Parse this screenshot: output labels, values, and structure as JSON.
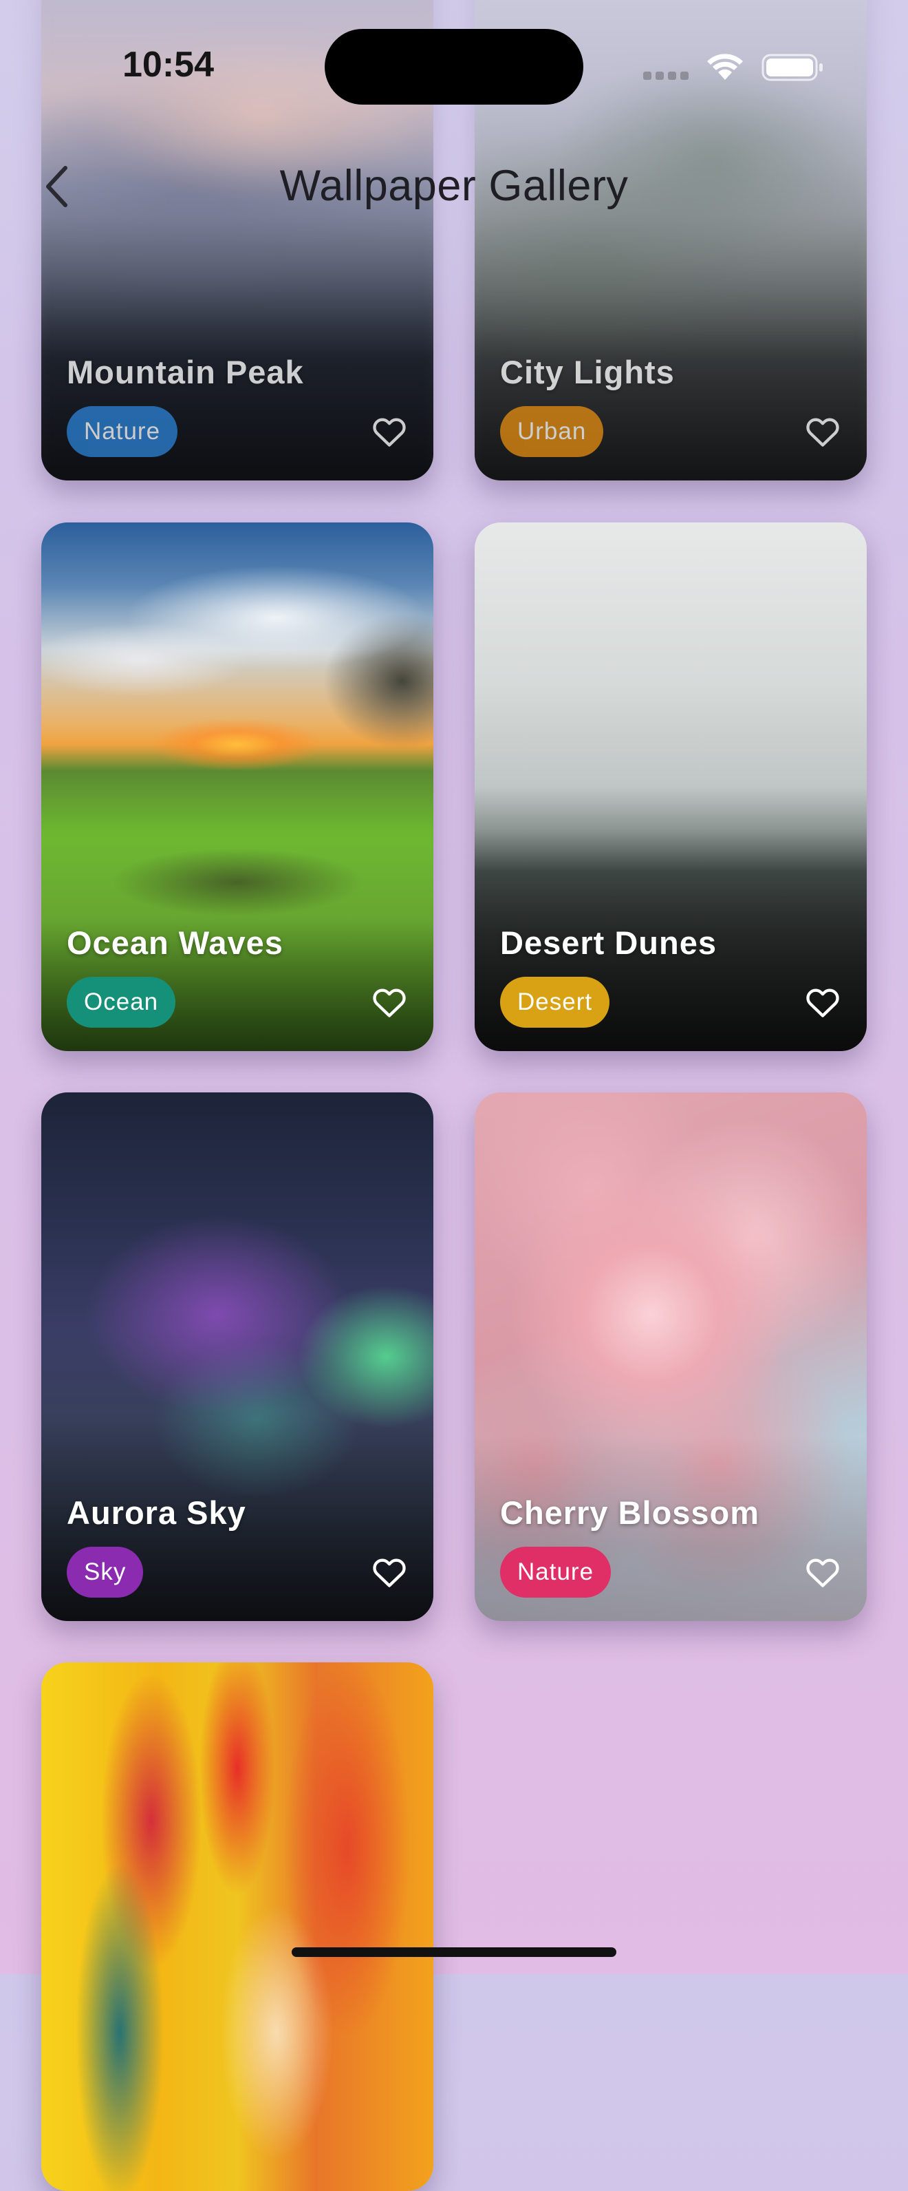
{
  "status_bar": {
    "time": "10:54"
  },
  "nav": {
    "title": "Wallpaper Gallery",
    "back_icon": "chevron-left-icon"
  },
  "cards": [
    {
      "title": "Mountain Peak",
      "tag": "Nature",
      "tag_color": "#2b7fd0",
      "favorite_icon": "heart-outline-icon"
    },
    {
      "title": "City Lights",
      "tag": "Urban",
      "tag_color": "#df8a12",
      "favorite_icon": "heart-outline-icon"
    },
    {
      "title": "Ocean Waves",
      "tag": "Ocean",
      "tag_color": "#15917a",
      "favorite_icon": "heart-outline-icon"
    },
    {
      "title": "Desert Dunes",
      "tag": "Desert",
      "tag_color": "#d9a214",
      "favorite_icon": "heart-outline-icon"
    },
    {
      "title": "Aurora Sky",
      "tag": "Sky",
      "tag_color": "#8a2bb0",
      "favorite_icon": "heart-outline-icon"
    },
    {
      "title": "Cherry Blossom",
      "tag": "Nature",
      "tag_color": "#df2f66",
      "favorite_icon": "heart-outline-icon"
    }
  ]
}
